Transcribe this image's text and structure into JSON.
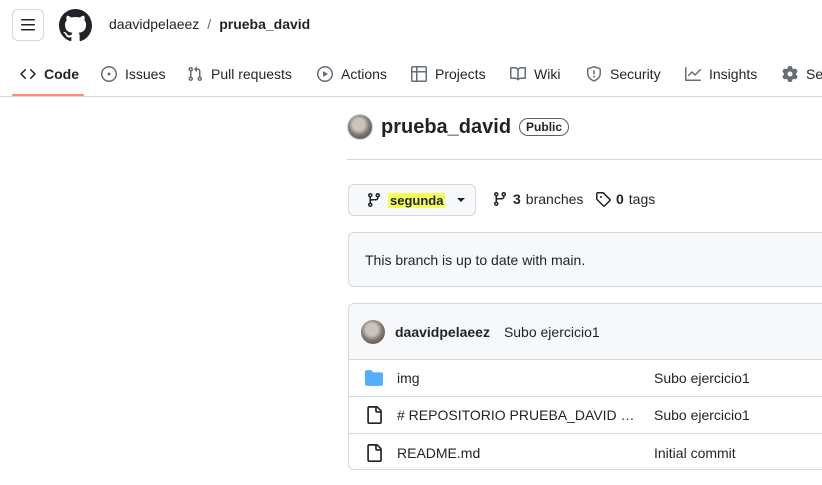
{
  "header": {
    "owner": "daavidpelaeez",
    "separator": "/",
    "repo": "prueba_david"
  },
  "nav": {
    "items": [
      {
        "label": "Code",
        "icon": "code-icon",
        "active": true
      },
      {
        "label": "Issues",
        "icon": "issue-icon"
      },
      {
        "label": "Pull requests",
        "icon": "pull-request-icon"
      },
      {
        "label": "Actions",
        "icon": "play-icon"
      },
      {
        "label": "Projects",
        "icon": "table-icon"
      },
      {
        "label": "Wiki",
        "icon": "book-icon"
      },
      {
        "label": "Security",
        "icon": "shield-icon"
      },
      {
        "label": "Insights",
        "icon": "graph-icon"
      },
      {
        "label": "Se",
        "icon": "gear-icon"
      }
    ]
  },
  "repo": {
    "name": "prueba_david",
    "visibility": "Public"
  },
  "branch": {
    "current": "segunda",
    "branches_count": "3",
    "branches_label": "branches",
    "tags_count": "0",
    "tags_label": "tags",
    "highlight_color": "#f5ff5a"
  },
  "status": {
    "message": "This branch is up to date with main."
  },
  "latest_commit": {
    "author": "daavidpelaeez",
    "message": "Subo ejercicio1"
  },
  "files": [
    {
      "name": "img",
      "type": "folder",
      "commit": "Subo ejercicio1"
    },
    {
      "name": "# REPOSITORIO PRUEBA_DAVID MARTINEZ",
      "type": "file",
      "commit": "Subo ejercicio1"
    },
    {
      "name": "README.md",
      "type": "file",
      "commit": "Initial commit"
    }
  ],
  "colors": {
    "accent_underline": "#fd8c73",
    "folder": "#54aeff",
    "border": "#d0d7de"
  }
}
